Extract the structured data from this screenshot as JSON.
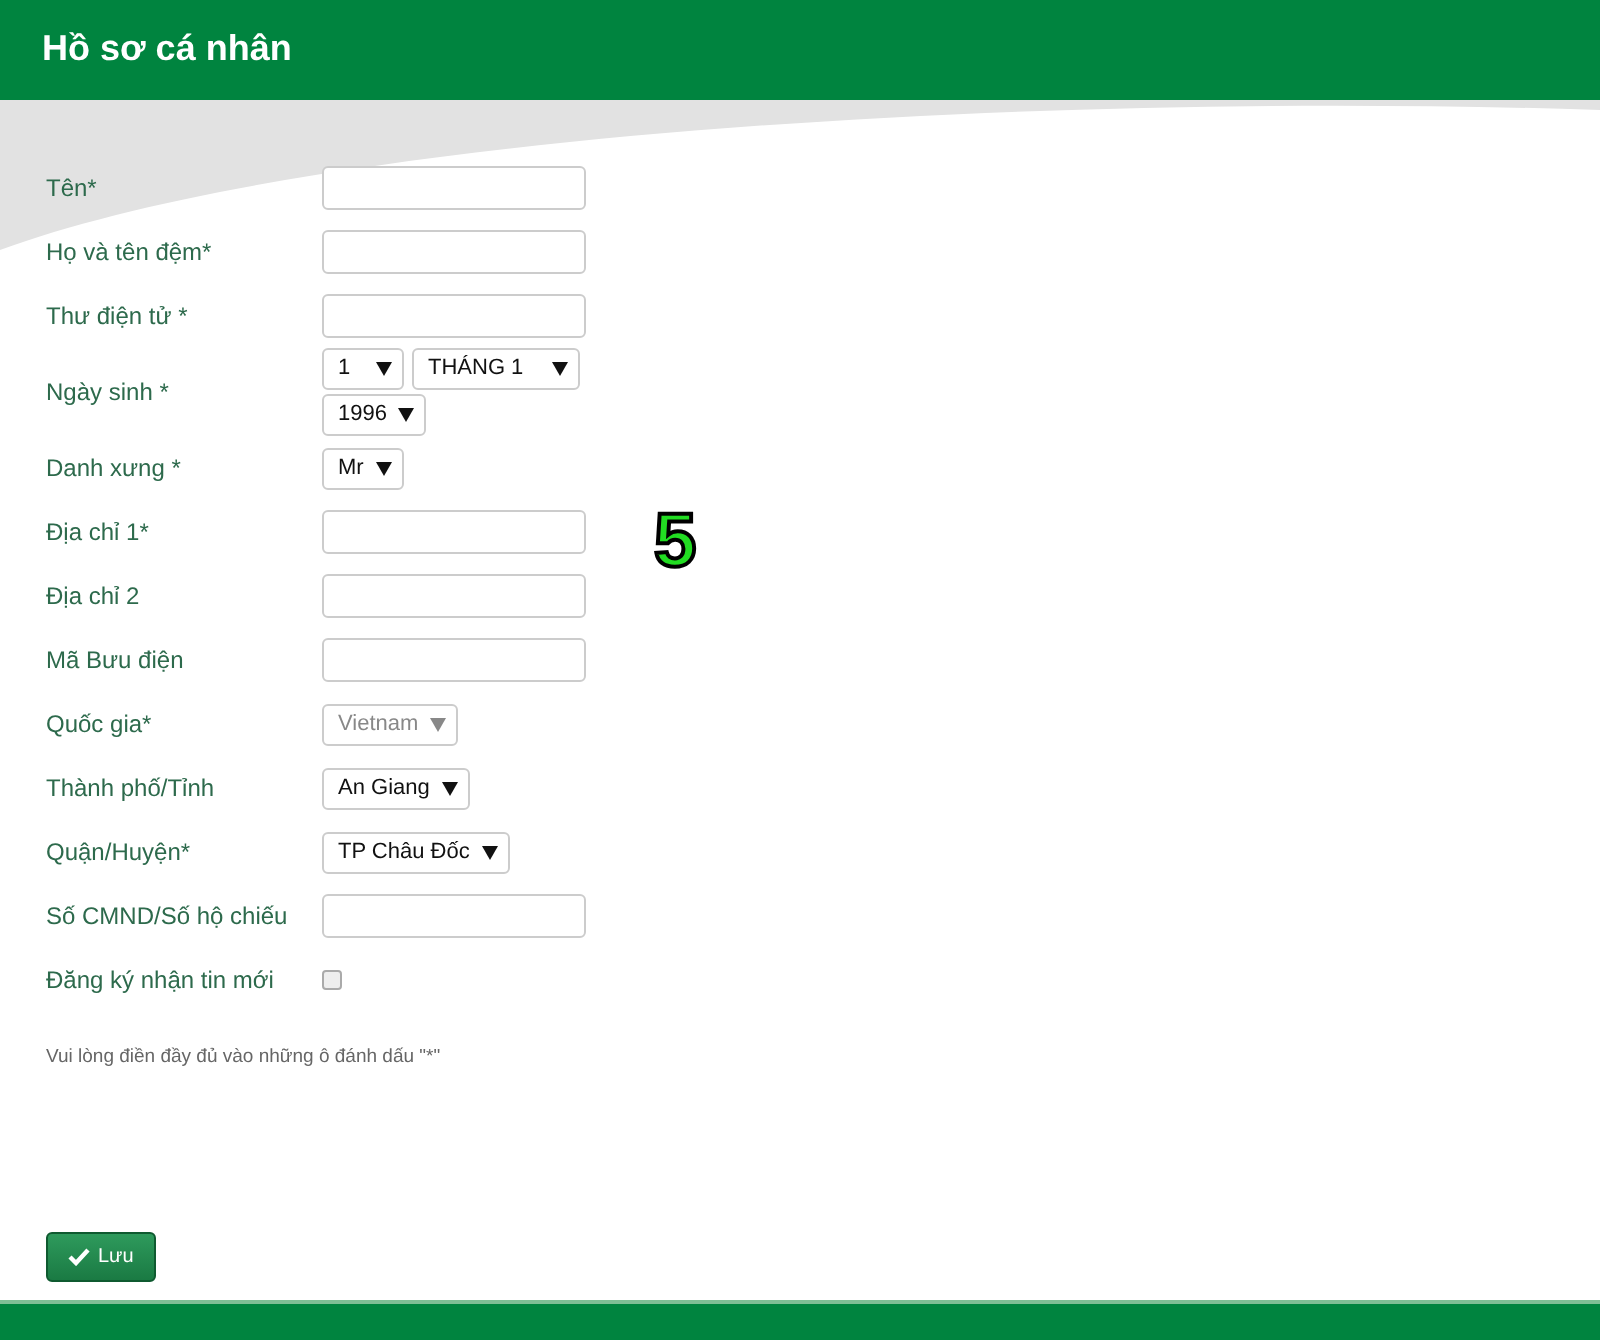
{
  "header": {
    "title": "Hồ sơ cá nhân"
  },
  "fields": [
    {
      "kind": "text",
      "label": "Tên*"
    },
    {
      "kind": "text",
      "label": "Họ và tên đệm*"
    },
    {
      "kind": "text",
      "label": "Thư điện tử *"
    },
    {
      "kind": "selects",
      "label": "Ngày sinh *",
      "selects": [
        {
          "value": "1",
          "disabled": false
        },
        {
          "value": "THÁNG 1",
          "disabled": false
        },
        {
          "value": "1996",
          "disabled": false
        }
      ]
    },
    {
      "kind": "selects",
      "label": "Danh xưng *",
      "selects": [
        {
          "value": "Mr",
          "disabled": false
        }
      ]
    },
    {
      "kind": "text",
      "label": "Địa chỉ 1*"
    },
    {
      "kind": "text",
      "label": "Địa chỉ 2"
    },
    {
      "kind": "text",
      "label": "Mã Bưu điện"
    },
    {
      "kind": "selects",
      "label": "Quốc gia*",
      "selects": [
        {
          "value": "Vietnam",
          "disabled": true
        }
      ]
    },
    {
      "kind": "selects",
      "label": "Thành phố/Tỉnh",
      "selects": [
        {
          "value": "An Giang",
          "disabled": false
        }
      ]
    },
    {
      "kind": "selects",
      "label": "Quận/Huyện*",
      "selects": [
        {
          "value": "TP Châu Đốc",
          "disabled": false
        }
      ]
    },
    {
      "kind": "text",
      "label": "Số CMND/Số hộ chiếu"
    },
    {
      "kind": "checkbox",
      "label": "Đăng ký nhận tin mới",
      "checked": false
    }
  ],
  "note": "Vui lòng điền đầy đủ vào những ô đánh dấu \"*\"",
  "step_marker": "5",
  "save_button": "Lưu"
}
